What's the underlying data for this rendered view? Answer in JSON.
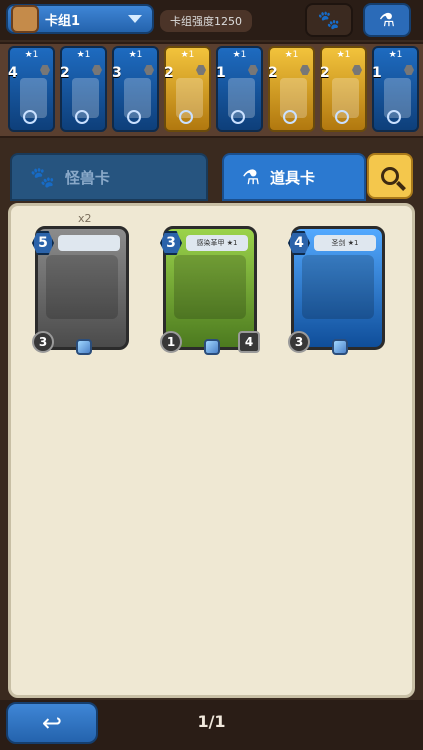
{
  "header": {
    "deck_name": "卡组1",
    "strength_label": "卡组强度1250",
    "tabs": [
      {
        "icon": "paw-icon",
        "active": false
      },
      {
        "icon": "potion-icon",
        "active": true
      }
    ]
  },
  "deck_cards": [
    {
      "stars": "★1",
      "cost": "4",
      "theme": "blue"
    },
    {
      "stars": "★1",
      "cost": "2",
      "theme": "blue"
    },
    {
      "stars": "★1",
      "cost": "3",
      "theme": "blue"
    },
    {
      "stars": "★1",
      "cost": "2",
      "theme": "gold"
    },
    {
      "stars": "★1",
      "cost": "1",
      "theme": "blue"
    },
    {
      "stars": "★1",
      "cost": "2",
      "theme": "gold"
    },
    {
      "stars": "★1",
      "cost": "2",
      "theme": "gold"
    },
    {
      "stars": "★1",
      "cost": "1",
      "theme": "blue"
    }
  ],
  "filter_tabs": {
    "monster": "怪兽卡",
    "item": "道具卡"
  },
  "collection": {
    "cards": [
      {
        "cost": "5",
        "title": "",
        "atk": "3",
        "count": "x2",
        "theme": "gray"
      },
      {
        "cost": "3",
        "title": "感染革甲 ★1",
        "atk": "1",
        "def": "4",
        "theme": "green"
      },
      {
        "cost": "4",
        "title": "圣剑 ★1",
        "atk": "3",
        "theme": "blue"
      }
    ]
  },
  "footer": {
    "back_icon": "back-arrow-icon",
    "pages": "1/1"
  },
  "colors": {
    "accent_blue": "#2b79d0",
    "accent_gold": "#f4c74c",
    "panel": "#efe8d3"
  }
}
